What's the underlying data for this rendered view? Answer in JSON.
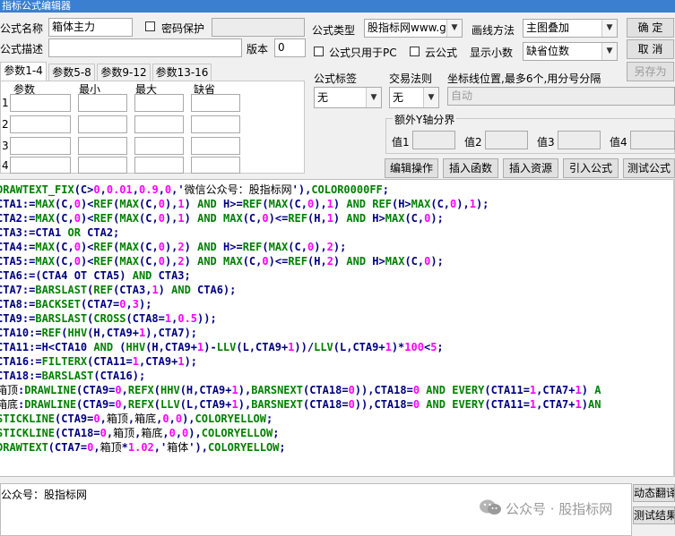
{
  "window": {
    "title": "指标公式编辑器"
  },
  "form": {
    "name_label": "公式名称",
    "name_value": "箱体主力",
    "password_label": "密码保护",
    "desc_label": "公式描述",
    "version_label": "版本",
    "version_value": "0",
    "type_label": "公式类型",
    "type_value": "股指标网www.g",
    "draw_label": "画线方法",
    "draw_value": "主图叠加",
    "pc_only_label": "公式只用于PC",
    "cloud_label": "云公式",
    "decimals_label": "显示小数",
    "decimals_value": "缺省位数"
  },
  "buttons": {
    "ok": "确 定",
    "cancel": "取 消",
    "save_as": "另存为",
    "edit_ops": "编辑操作",
    "insert_func": "插入函数",
    "insert_res": "插入资源",
    "import_formula": "引入公式",
    "test_formula": "测试公式"
  },
  "tabs": [
    "参数1-4",
    "参数5-8",
    "参数9-12",
    "参数13-16"
  ],
  "param_table": {
    "headers": [
      "参数",
      "最小",
      "最大",
      "缺省"
    ],
    "rows": [
      "1",
      "2",
      "3",
      "4"
    ]
  },
  "options": {
    "formula_tag_label": "公式标签",
    "formula_tag_value": "无",
    "trade_rule_label": "交易法则",
    "trade_rule_value": "无",
    "coord_label": "坐标线位置,最多6个,用分号分隔",
    "coord_value": "自动",
    "extra_y_label": "额外Y轴分界",
    "values": [
      "值1",
      "值2",
      "值3",
      "值4"
    ]
  },
  "code_lines": [
    [
      [
        "DRAWTEXT_FIX",
        "k"
      ],
      [
        "(C>",
        "v"
      ],
      [
        "0",
        "n"
      ],
      [
        ",",
        "v"
      ],
      [
        "0.01",
        "n"
      ],
      [
        ",",
        "v"
      ],
      [
        "0.9",
        "n"
      ],
      [
        ",",
        "v"
      ],
      [
        "0",
        "n"
      ],
      [
        ",'",
        "v"
      ],
      [
        "微信公众号：股指标网",
        "s"
      ],
      [
        "'),",
        "v"
      ],
      [
        "COLOR0000FF",
        "k"
      ],
      [
        ";",
        "v"
      ]
    ],
    [
      [
        "CTA1:=",
        "v"
      ],
      [
        "MAX",
        "k"
      ],
      [
        "(C,",
        "v"
      ],
      [
        "0",
        "n"
      ],
      [
        ")<",
        "v"
      ],
      [
        "REF",
        "k"
      ],
      [
        "(",
        "v"
      ],
      [
        "MAX",
        "k"
      ],
      [
        "(C,",
        "v"
      ],
      [
        "0",
        "n"
      ],
      [
        "),",
        "v"
      ],
      [
        "1",
        "n"
      ],
      [
        ") ",
        "v"
      ],
      [
        "AND",
        "k"
      ],
      [
        " H>=",
        "v"
      ],
      [
        "REF",
        "k"
      ],
      [
        "(",
        "v"
      ],
      [
        "MAX",
        "k"
      ],
      [
        "(C,",
        "v"
      ],
      [
        "0",
        "n"
      ],
      [
        "),",
        "v"
      ],
      [
        "1",
        "n"
      ],
      [
        ") ",
        "v"
      ],
      [
        "AND",
        "k"
      ],
      [
        " ",
        "v"
      ],
      [
        "REF",
        "k"
      ],
      [
        "(H>",
        "v"
      ],
      [
        "MAX",
        "k"
      ],
      [
        "(C,",
        "v"
      ],
      [
        "0",
        "n"
      ],
      [
        "),",
        "v"
      ],
      [
        "1",
        "n"
      ],
      [
        ");",
        "v"
      ]
    ],
    [
      [
        "CTA2:=",
        "v"
      ],
      [
        "MAX",
        "k"
      ],
      [
        "(C,",
        "v"
      ],
      [
        "0",
        "n"
      ],
      [
        ")<",
        "v"
      ],
      [
        "REF",
        "k"
      ],
      [
        "(",
        "v"
      ],
      [
        "MAX",
        "k"
      ],
      [
        "(C,",
        "v"
      ],
      [
        "0",
        "n"
      ],
      [
        "),",
        "v"
      ],
      [
        "1",
        "n"
      ],
      [
        ") ",
        "v"
      ],
      [
        "AND",
        "k"
      ],
      [
        " ",
        "v"
      ],
      [
        "MAX",
        "k"
      ],
      [
        "(C,",
        "v"
      ],
      [
        "0",
        "n"
      ],
      [
        ")<=",
        "v"
      ],
      [
        "REF",
        "k"
      ],
      [
        "(H,",
        "v"
      ],
      [
        "1",
        "n"
      ],
      [
        ") ",
        "v"
      ],
      [
        "AND",
        "k"
      ],
      [
        " H>",
        "v"
      ],
      [
        "MAX",
        "k"
      ],
      [
        "(C,",
        "v"
      ],
      [
        "0",
        "n"
      ],
      [
        ");",
        "v"
      ]
    ],
    [
      [
        "CTA3:=CTA1 ",
        "v"
      ],
      [
        "OR",
        "k"
      ],
      [
        " CTA2;",
        "v"
      ]
    ],
    [
      [
        "CTA4:=",
        "v"
      ],
      [
        "MAX",
        "k"
      ],
      [
        "(C,",
        "v"
      ],
      [
        "0",
        "n"
      ],
      [
        ")<",
        "v"
      ],
      [
        "REF",
        "k"
      ],
      [
        "(",
        "v"
      ],
      [
        "MAX",
        "k"
      ],
      [
        "(C,",
        "v"
      ],
      [
        "0",
        "n"
      ],
      [
        "),",
        "v"
      ],
      [
        "2",
        "n"
      ],
      [
        ") ",
        "v"
      ],
      [
        "AND",
        "k"
      ],
      [
        " H>=",
        "v"
      ],
      [
        "REF",
        "k"
      ],
      [
        "(",
        "v"
      ],
      [
        "MAX",
        "k"
      ],
      [
        "(C,",
        "v"
      ],
      [
        "0",
        "n"
      ],
      [
        "),",
        "v"
      ],
      [
        "2",
        "n"
      ],
      [
        ");",
        "v"
      ]
    ],
    [
      [
        "CTA5:=",
        "v"
      ],
      [
        "MAX",
        "k"
      ],
      [
        "(C,",
        "v"
      ],
      [
        "0",
        "n"
      ],
      [
        ")<",
        "v"
      ],
      [
        "REF",
        "k"
      ],
      [
        "(",
        "v"
      ],
      [
        "MAX",
        "k"
      ],
      [
        "(C,",
        "v"
      ],
      [
        "0",
        "n"
      ],
      [
        "),",
        "v"
      ],
      [
        "2",
        "n"
      ],
      [
        ") ",
        "v"
      ],
      [
        "AND",
        "k"
      ],
      [
        " ",
        "v"
      ],
      [
        "MAX",
        "k"
      ],
      [
        "(C,",
        "v"
      ],
      [
        "0",
        "n"
      ],
      [
        ")<=",
        "v"
      ],
      [
        "REF",
        "k"
      ],
      [
        "(H,",
        "v"
      ],
      [
        "2",
        "n"
      ],
      [
        ") ",
        "v"
      ],
      [
        "AND",
        "k"
      ],
      [
        " H>",
        "v"
      ],
      [
        "MAX",
        "k"
      ],
      [
        "(C,",
        "v"
      ],
      [
        "0",
        "n"
      ],
      [
        ");",
        "v"
      ]
    ],
    [
      [
        "CTA6:=(CTA4 OT CTA5) ",
        "v"
      ],
      [
        "AND",
        "k"
      ],
      [
        " CTA3;",
        "v"
      ]
    ],
    [
      [
        "CTA7:=",
        "v"
      ],
      [
        "BARSLAST",
        "k"
      ],
      [
        "(",
        "v"
      ],
      [
        "REF",
        "k"
      ],
      [
        "(CTA3,",
        "v"
      ],
      [
        "1",
        "n"
      ],
      [
        ") ",
        "v"
      ],
      [
        "AND",
        "k"
      ],
      [
        " CTA6);",
        "v"
      ]
    ],
    [
      [
        "CTA8:=",
        "v"
      ],
      [
        "BACKSET",
        "k"
      ],
      [
        "(CTA7=",
        "v"
      ],
      [
        "0",
        "n"
      ],
      [
        ",",
        "v"
      ],
      [
        "3",
        "n"
      ],
      [
        ");",
        "v"
      ]
    ],
    [
      [
        "CTA9:=",
        "v"
      ],
      [
        "BARSLAST",
        "k"
      ],
      [
        "(",
        "v"
      ],
      [
        "CROSS",
        "k"
      ],
      [
        "(CTA8=",
        "v"
      ],
      [
        "1",
        "n"
      ],
      [
        ",",
        "v"
      ],
      [
        "0.5",
        "n"
      ],
      [
        "));",
        "v"
      ]
    ],
    [
      [
        "CTA10:=",
        "v"
      ],
      [
        "REF",
        "k"
      ],
      [
        "(",
        "v"
      ],
      [
        "HHV",
        "k"
      ],
      [
        "(H,CTA9+",
        "v"
      ],
      [
        "1",
        "n"
      ],
      [
        "),CTA7);",
        "v"
      ]
    ],
    [
      [
        "CTA11:=H<CTA10 ",
        "v"
      ],
      [
        "AND",
        "k"
      ],
      [
        " (",
        "v"
      ],
      [
        "HHV",
        "k"
      ],
      [
        "(H,CTA9+",
        "v"
      ],
      [
        "1",
        "n"
      ],
      [
        ")-",
        "v"
      ],
      [
        "LLV",
        "k"
      ],
      [
        "(L,CTA9+",
        "v"
      ],
      [
        "1",
        "n"
      ],
      [
        "))/",
        "v"
      ],
      [
        "LLV",
        "k"
      ],
      [
        "(L,CTA9+",
        "v"
      ],
      [
        "1",
        "n"
      ],
      [
        ")*",
        "v"
      ],
      [
        "100",
        "n"
      ],
      [
        "<",
        "v"
      ],
      [
        "5",
        "n"
      ],
      [
        ";",
        "v"
      ]
    ],
    [
      [
        "CTA16:=",
        "v"
      ],
      [
        "FILTERX",
        "k"
      ],
      [
        "(CTA11=",
        "v"
      ],
      [
        "1",
        "n"
      ],
      [
        ",CTA9+",
        "v"
      ],
      [
        "1",
        "n"
      ],
      [
        ");",
        "v"
      ]
    ],
    [
      [
        "CTA18:=",
        "v"
      ],
      [
        "BARSLAST",
        "k"
      ],
      [
        "(CTA16);",
        "v"
      ]
    ],
    [
      [
        "箱顶",
        "s"
      ],
      [
        ":",
        "v"
      ],
      [
        "DRAWLINE",
        "k"
      ],
      [
        "(CTA9=",
        "v"
      ],
      [
        "0",
        "n"
      ],
      [
        ",",
        "v"
      ],
      [
        "REFX",
        "k"
      ],
      [
        "(",
        "v"
      ],
      [
        "HHV",
        "k"
      ],
      [
        "(H,CTA9+",
        "v"
      ],
      [
        "1",
        "n"
      ],
      [
        "),",
        "v"
      ],
      [
        "BARSNEXT",
        "k"
      ],
      [
        "(CTA18=",
        "v"
      ],
      [
        "0",
        "n"
      ],
      [
        ")),CTA18=",
        "v"
      ],
      [
        "0",
        "n"
      ],
      [
        " ",
        "v"
      ],
      [
        "AND",
        "k"
      ],
      [
        " ",
        "v"
      ],
      [
        "EVERY",
        "k"
      ],
      [
        "(CTA11=",
        "v"
      ],
      [
        "1",
        "n"
      ],
      [
        ",CTA7+",
        "v"
      ],
      [
        "1",
        "n"
      ],
      [
        ") ",
        "v"
      ],
      [
        "A",
        "k"
      ]
    ],
    [
      [
        "箱底",
        "s"
      ],
      [
        ":",
        "v"
      ],
      [
        "DRAWLINE",
        "k"
      ],
      [
        "(CTA9=",
        "v"
      ],
      [
        "0",
        "n"
      ],
      [
        ",",
        "v"
      ],
      [
        "REFX",
        "k"
      ],
      [
        "(",
        "v"
      ],
      [
        "LLV",
        "k"
      ],
      [
        "(L,CTA9+",
        "v"
      ],
      [
        "1",
        "n"
      ],
      [
        "),",
        "v"
      ],
      [
        "BARSNEXT",
        "k"
      ],
      [
        "(CTA18=",
        "v"
      ],
      [
        "0",
        "n"
      ],
      [
        ")),CTA18=",
        "v"
      ],
      [
        "0",
        "n"
      ],
      [
        " ",
        "v"
      ],
      [
        "AND",
        "k"
      ],
      [
        " ",
        "v"
      ],
      [
        "EVERY",
        "k"
      ],
      [
        "(CTA11=",
        "v"
      ],
      [
        "1",
        "n"
      ],
      [
        ",CTA7+",
        "v"
      ],
      [
        "1",
        "n"
      ],
      [
        ")",
        "v"
      ],
      [
        "AN",
        "k"
      ]
    ],
    [
      [
        "STICKLINE",
        "k"
      ],
      [
        "(CTA9=",
        "v"
      ],
      [
        "0",
        "n"
      ],
      [
        ",",
        "v"
      ],
      [
        "箱顶",
        "s"
      ],
      [
        ",",
        "v"
      ],
      [
        "箱底",
        "s"
      ],
      [
        ",",
        "v"
      ],
      [
        "0",
        "n"
      ],
      [
        ",",
        "v"
      ],
      [
        "0",
        "n"
      ],
      [
        "),",
        "v"
      ],
      [
        "COLORYELLOW",
        "k"
      ],
      [
        ";",
        "v"
      ]
    ],
    [
      [
        "STICKLINE",
        "k"
      ],
      [
        "(CTA18=",
        "v"
      ],
      [
        "0",
        "n"
      ],
      [
        ",",
        "v"
      ],
      [
        "箱顶",
        "s"
      ],
      [
        ",",
        "v"
      ],
      [
        "箱底",
        "s"
      ],
      [
        ",",
        "v"
      ],
      [
        "0",
        "n"
      ],
      [
        ",",
        "v"
      ],
      [
        "0",
        "n"
      ],
      [
        "),",
        "v"
      ],
      [
        "COLORYELLOW",
        "k"
      ],
      [
        ";",
        "v"
      ]
    ],
    [
      [
        "DRAWTEXT",
        "k"
      ],
      [
        "(CTA7=",
        "v"
      ],
      [
        "0",
        "n"
      ],
      [
        ",",
        "v"
      ],
      [
        "箱顶",
        "s"
      ],
      [
        "*",
        "v"
      ],
      [
        "1.02",
        "n"
      ],
      [
        ",'",
        "v"
      ],
      [
        "箱体",
        "s"
      ],
      [
        "'),",
        "v"
      ],
      [
        "COLORYELLOW",
        "k"
      ],
      [
        ";",
        "v"
      ]
    ]
  ],
  "bottom": {
    "text": "公众号：股指标网",
    "side_btn1": "动态翻译",
    "side_btn2": "测试结果",
    "watermark": "公众号 · 股指标网"
  }
}
